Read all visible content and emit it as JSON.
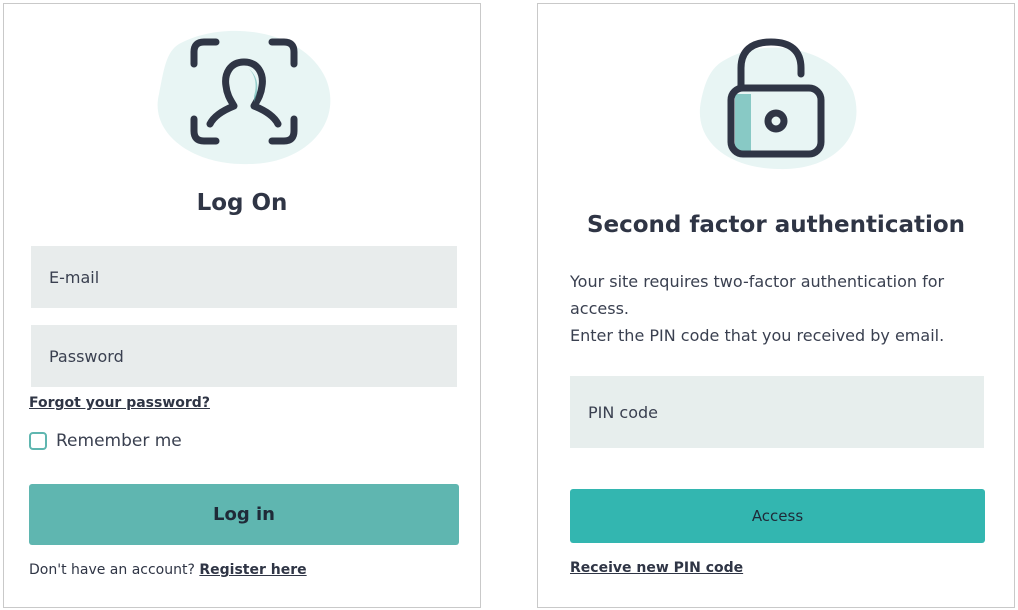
{
  "login": {
    "title": "Log On",
    "email_placeholder": "E-mail",
    "password_placeholder": "Password",
    "forgot_link": "Forgot your password?",
    "remember_label": "Remember me",
    "login_button": "Log in",
    "no_account_text": "Don't have an account?",
    "register_link": "Register here",
    "icon": "user-face-scan-icon"
  },
  "tfa": {
    "title": "Second factor authentication",
    "description_line1": "Your site requires two-factor authentication for access.",
    "description_line2": "Enter the PIN code that you received by email.",
    "pin_placeholder": "PIN code",
    "access_button": "Access",
    "receive_link": "Receive new PIN code",
    "icon": "unlocked-padlock-icon"
  },
  "colors": {
    "accent": "#5fb6b0",
    "access_button": "#33b6b0",
    "blob": "#e8f5f4",
    "icon_stroke": "#2f3545",
    "field_bg": "#e8ecec"
  }
}
